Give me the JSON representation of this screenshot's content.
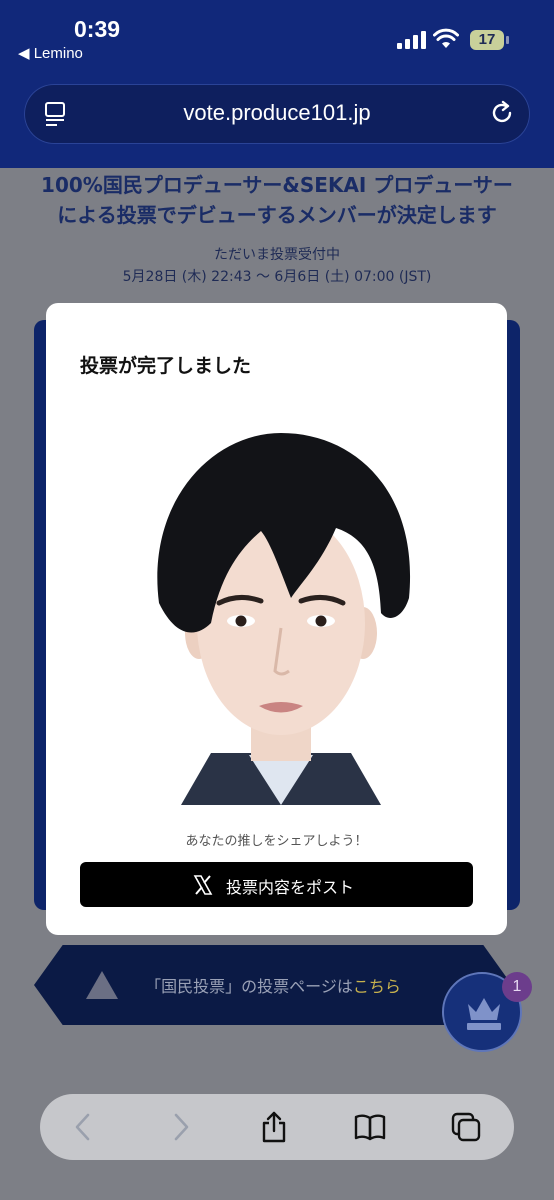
{
  "status_bar": {
    "time": "0:39",
    "back_app": "◀ Lemino",
    "battery": "17"
  },
  "browser": {
    "url": "vote.produce101.jp"
  },
  "page": {
    "headline_line1": "100%国民プロデューサー&SEKAI プロデューサー",
    "headline_line2": "による投票でデビューするメンバーが決定します",
    "status": "ただいま投票受付中",
    "period": "5月28日 (木) 22:43 〜 6月6日 (土) 07:00 (JST)",
    "banner_prefix": "「国民投票」の投票ページは",
    "banner_link": "こちら",
    "notification_count": "1"
  },
  "modal": {
    "title": "投票が完了しました",
    "share_prompt": "あなたの推しをシェアしよう！",
    "post_button": "投票内容をポスト"
  },
  "colors": {
    "accent_blue": "#11287a",
    "banner_link": "#c8b24e"
  }
}
